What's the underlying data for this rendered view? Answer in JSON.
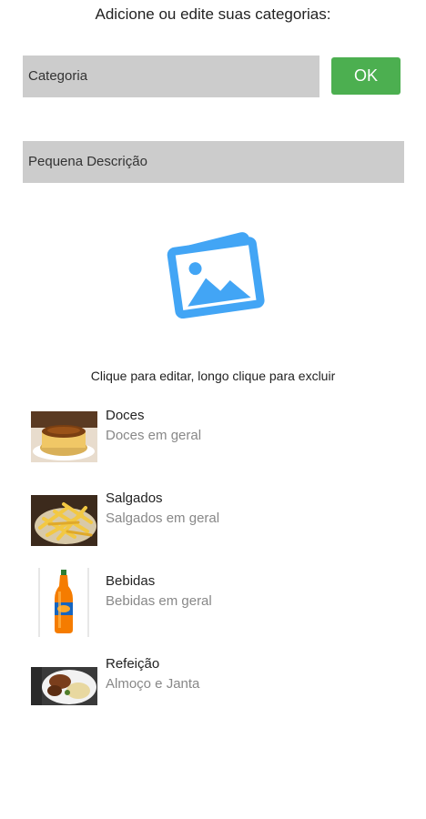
{
  "header": {
    "title": "Adicione ou edite suas categorias:"
  },
  "form": {
    "category_placeholder": "Categoria",
    "ok_label": "OK",
    "description_placeholder": "Pequena Descrição"
  },
  "image_picker": {
    "icon": "image-gallery-icon",
    "color": "#42a5f5"
  },
  "hint": "Clique para editar, longo clique para excluir",
  "categories": [
    {
      "title": "Doces",
      "description": "Doces em geral",
      "image": "flan-dessert-photo"
    },
    {
      "title": "Salgados",
      "description": "Salgados em geral",
      "image": "french-fries-photo"
    },
    {
      "title": "Bebidas",
      "description": "Bebidas em geral",
      "image": "orange-soda-bottle-photo"
    },
    {
      "title": "Refeição",
      "description": "Almoço e Janta",
      "image": "meal-plate-photo"
    }
  ],
  "colors": {
    "accent": "#4caf50",
    "input_bg": "#cccccc",
    "secondary_text": "#888888"
  }
}
